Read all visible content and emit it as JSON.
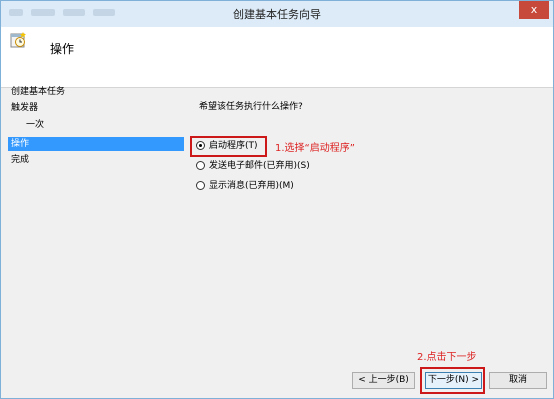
{
  "window": {
    "title": "创建基本任务向导",
    "close_glyph": "x"
  },
  "header": {
    "icon": "task-wizard-icon",
    "title": "操作"
  },
  "nav": {
    "items": [
      {
        "label": "创建基本任务"
      },
      {
        "label": "触发器"
      },
      {
        "label": "一次"
      },
      {
        "label": "操作"
      },
      {
        "label": "完成"
      }
    ],
    "selected_index": 3
  },
  "main": {
    "question": "希望该任务执行什么操作?",
    "options": [
      {
        "label": "启动程序(T)",
        "checked": true
      },
      {
        "label": "发送电子邮件(已弃用)(S)",
        "checked": false
      },
      {
        "label": "显示消息(已弃用)(M)",
        "checked": false
      }
    ]
  },
  "annotations": {
    "step1": "1.选择“启动程序”",
    "step2": "2.点击下一步",
    "color": "#d22222"
  },
  "footer": {
    "back_label": "< 上一步(B)",
    "next_label": "下一步(N) >",
    "cancel_label": "取消"
  },
  "colors": {
    "selection": "#3399ff",
    "highlight_box": "#cc1818",
    "title_bg": "#dcebf7",
    "close_btn": "#c7493b"
  }
}
